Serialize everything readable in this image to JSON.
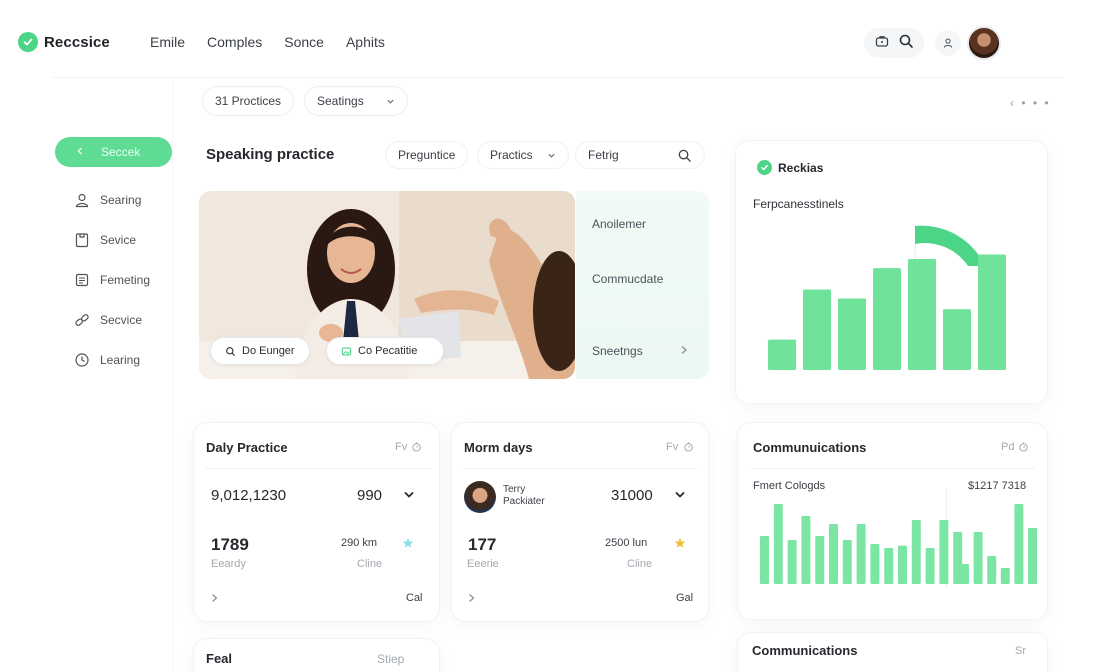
{
  "header": {
    "brand": "Reccsice",
    "nav": [
      "Emile",
      "Comples",
      "Sonce",
      "Aphits"
    ]
  },
  "toolbar": {
    "practices_label": "31 Proctices",
    "settings_label": "Seatings",
    "pager": "‹ • • •"
  },
  "sidebar": {
    "active_label": "Seccek",
    "items": [
      {
        "label": "Searing",
        "icon": "user-icon"
      },
      {
        "label": "Sevice",
        "icon": "clipboard-icon"
      },
      {
        "label": "Femeting",
        "icon": "document-icon"
      },
      {
        "label": "Secvice",
        "icon": "link-icon"
      },
      {
        "label": "Learing",
        "icon": "clock-icon"
      }
    ]
  },
  "speaking": {
    "title": "Speaking practice",
    "chips": [
      "Preguntice",
      "Practics"
    ],
    "search_value": "Fetrig"
  },
  "hero": {
    "btn1": "Do Eunger",
    "btn2": "Co Pecatitie"
  },
  "hero_side": {
    "items": [
      "Anoilemer",
      "Commucdate",
      "Sneetngs"
    ]
  },
  "right_card": {
    "title": "Reckias",
    "subtitle": "Ferpcanesstinels",
    "bars": [
      0.2,
      0.53,
      0.47,
      0.67,
      0.73,
      0.4,
      0.76
    ],
    "accent": "#6fe39a"
  },
  "daily": {
    "title": "Daly Practice",
    "corner": "Fv",
    "row1_left": "9,012,1230",
    "row1_right": "990",
    "stat_value": "1789",
    "stat_label": "Eeardy",
    "stat2_value": "290 km",
    "stat2_label": "Cline",
    "footer_right": "Cal"
  },
  "morn": {
    "title": "Morm days",
    "corner": "Fv",
    "person_first": "Terry",
    "person_last": "Packiater",
    "row1_right": "31000",
    "stat_value": "177",
    "stat_label": "Eeerie",
    "stat2_value": "2500 lun",
    "stat2_label": "Cline",
    "footer_right": "Gal"
  },
  "comms": {
    "title": "Communuications",
    "corner": "Pd",
    "sub_left": "Fmert Cologds",
    "sub_right": "$1217 7318",
    "bars_left": [
      0.6,
      1.0,
      0.55,
      0.85,
      0.6,
      0.75,
      0.55,
      0.75,
      0.5,
      0.45,
      0.48,
      0.8,
      0.45,
      0.8,
      0.65
    ],
    "bars_right": [
      0.25,
      0.65,
      0.35,
      0.2,
      1.0,
      0.7
    ],
    "accent": "#7be6a4"
  },
  "bottom": {
    "feal": "Feal",
    "step": "Stiep",
    "comms2": "Communications",
    "comms2_corner": "Sr"
  }
}
